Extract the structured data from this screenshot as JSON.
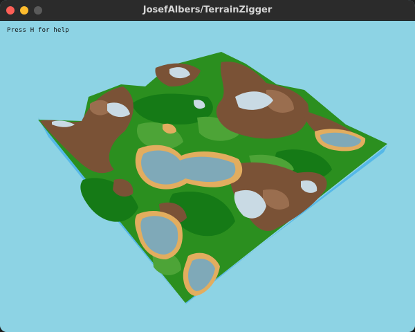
{
  "window": {
    "title": "JosefAlbers/TerrainZigger"
  },
  "viewport": {
    "help_text": "Press H for help",
    "background_color": "#8dd3e4"
  },
  "terrain": {
    "colors": {
      "grass_dark": "#157a16",
      "grass": "#2b8f1f",
      "grass_light": "#4da437",
      "sand": "#e2ad5f",
      "rock": "#7a5236",
      "rock_light": "#9a6e4f",
      "water": "#7fa9b8",
      "snow": "#c9dae4",
      "sea_side": "#55b8e8"
    }
  }
}
